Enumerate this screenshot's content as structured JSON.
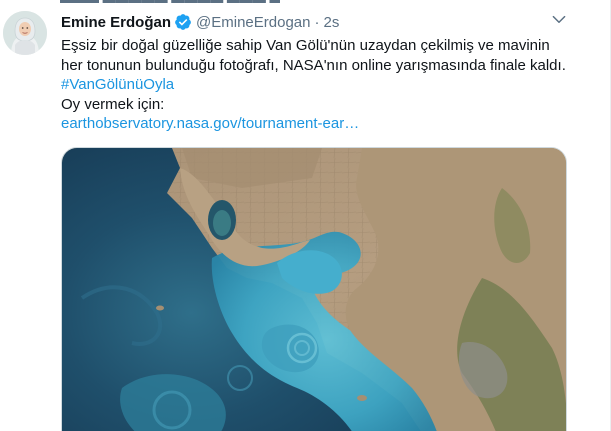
{
  "tweet": {
    "author": {
      "display_name": "Emine Erdoğan",
      "handle": "@EmineErdogan",
      "verified": true
    },
    "separator": "·",
    "timestamp": "2s",
    "text_line1": "Eşsiz bir doğal güzelliğe sahip Van Gölü'nün uzaydan çekilmiş ve mavinin",
    "text_line2": "her tonunun bulunduğu fotoğrafı, NASA'nın online yarışmasında finale kaldı.",
    "hashtag": "#VanGölünüOyla",
    "text_line4": "Oy vermek için:",
    "link": "earthobservatory.nasa.gov/tournament-ear…"
  },
  "icons": {
    "verified": "verified-badge-icon",
    "more": "more-options-icon"
  },
  "colors": {
    "accent": "#1b95e0",
    "text": "#0f1419",
    "secondary": "#5b7083"
  }
}
